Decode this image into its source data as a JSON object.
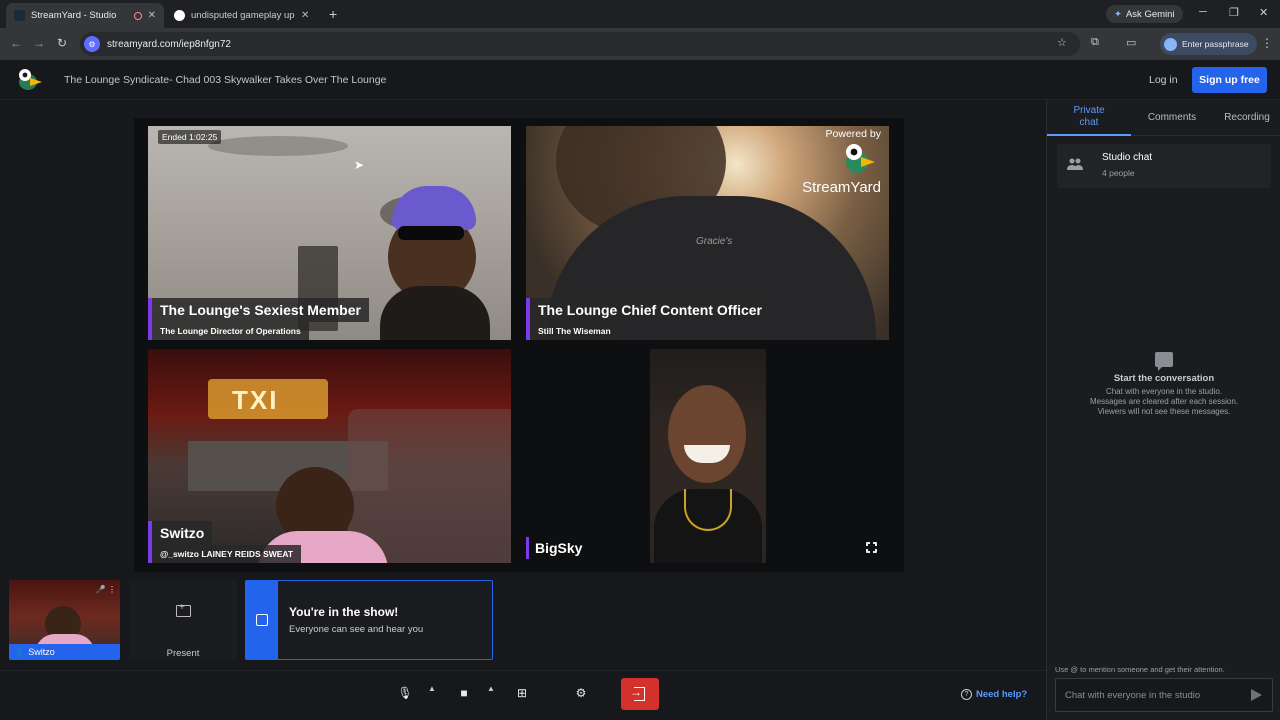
{
  "browser": {
    "tabs": [
      {
        "title": "StreamYard - Studio"
      },
      {
        "title": "undisputed gameplay updated"
      }
    ],
    "ask_gemini": "Ask Gemini",
    "url": "streamyard.com/iep8nfgn72",
    "passphrase": "Enter passphrase"
  },
  "header": {
    "show_title": "The Lounge Syndicate- Chad 003 Skywalker Takes Over The Lounge",
    "login": "Log in",
    "signup": "Sign up free"
  },
  "stage": {
    "ended": "Ended 1:02:25",
    "powered_by": "Powered by",
    "brand": "StreamYard",
    "participants": [
      {
        "name": "The Lounge's Sexiest Member",
        "subtitle": "The Lounge Director of Operations"
      },
      {
        "name": "The Lounge Chief Content Officer",
        "subtitle": "Still The Wiseman"
      },
      {
        "name": "Switzo",
        "subtitle": "@_switzo LAINEY REIDS SWEAT"
      },
      {
        "name": "BigSky"
      }
    ]
  },
  "sidebar": {
    "tabs": [
      "Private chat",
      "Comments",
      "Recording"
    ],
    "studio_chat_title": "Studio chat",
    "studio_chat_count": "4 people",
    "empty_title": "Start the conversation",
    "empty_lines": [
      "Chat with everyone in the studio.",
      "Messages are cleared after each session.",
      "Viewers will not see these messages."
    ],
    "mention_hint": "Use @ to mention someone and get their attention.",
    "chat_placeholder": "Chat with everyone in the studio"
  },
  "bottom": {
    "self_name": "Switzo",
    "present_label": "Present",
    "inshow_title": "You're in the show!",
    "inshow_sub": "Everyone can see and hear you",
    "help": "Need help?"
  },
  "colors": {
    "accent": "#2463eb",
    "nameplate_bar": "#7c3aed",
    "leave": "#d3312c"
  }
}
